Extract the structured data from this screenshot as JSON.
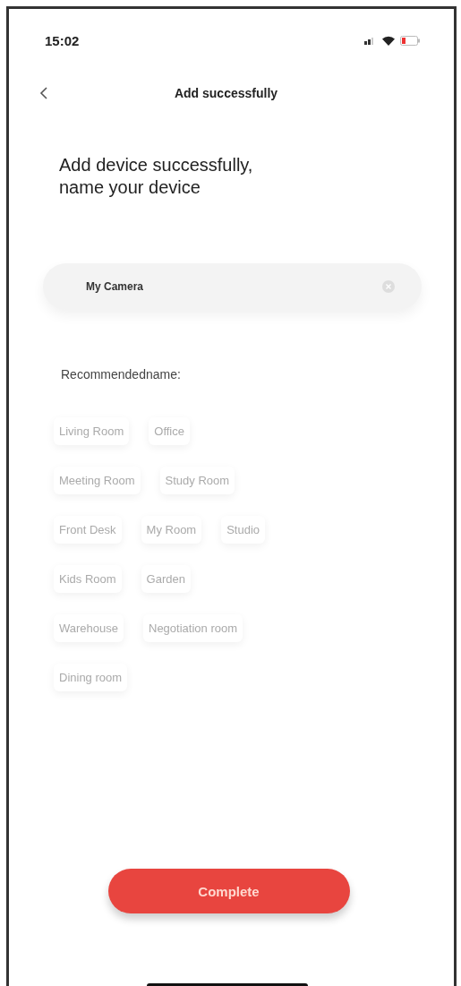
{
  "status_bar": {
    "time": "15:02"
  },
  "nav": {
    "title": "Add successfully"
  },
  "heading": "Add device successfully,\n name your device",
  "name_field": {
    "value": "My Camera"
  },
  "recommended": {
    "label": "Recommendedname:",
    "rows": [
      [
        "Living Room",
        "Office"
      ],
      [
        "Meeting Room",
        "Study Room"
      ],
      [
        "Front Desk",
        "My Room",
        "Studio"
      ],
      [
        "Kids Room",
        "Garden"
      ],
      [
        "Warehouse",
        "Negotiation room"
      ],
      [
        "Dining room"
      ]
    ]
  },
  "button": "Complete"
}
